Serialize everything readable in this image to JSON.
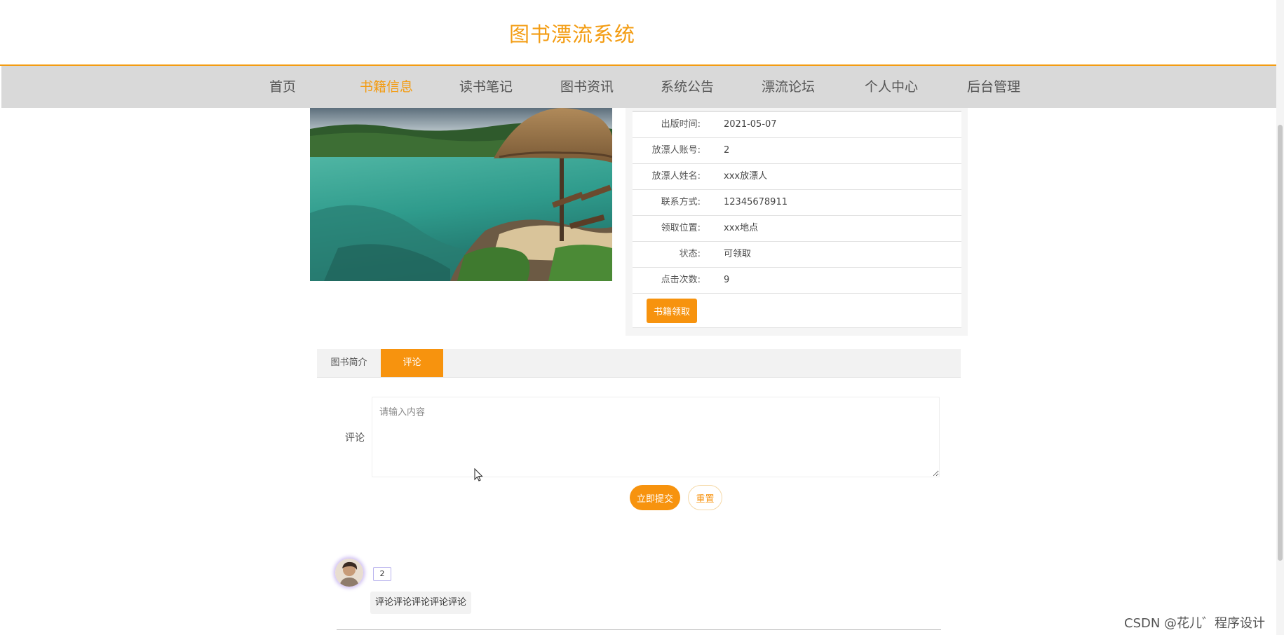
{
  "header": {
    "site_title": "图书漂流系统"
  },
  "nav": {
    "items": [
      {
        "label": "首页",
        "active": false
      },
      {
        "label": "书籍信息",
        "active": true
      },
      {
        "label": "读书笔记",
        "active": false
      },
      {
        "label": "图书资讯",
        "active": false
      },
      {
        "label": "系统公告",
        "active": false
      },
      {
        "label": "漂流论坛",
        "active": false
      },
      {
        "label": "个人中心",
        "active": false
      },
      {
        "label": "后台管理",
        "active": false
      }
    ]
  },
  "book": {
    "details": [
      {
        "label": "出版时间:",
        "value": "2021-05-07"
      },
      {
        "label": "放漂人账号:",
        "value": "2"
      },
      {
        "label": "放漂人姓名:",
        "value": "xxx放漂人"
      },
      {
        "label": "联系方式:",
        "value": "12345678911"
      },
      {
        "label": "领取位置:",
        "value": "xxx地点"
      },
      {
        "label": "状态:",
        "value": "可领取"
      },
      {
        "label": "点击次数:",
        "value": "9"
      }
    ],
    "claim_button": "书籍领取"
  },
  "tabs": {
    "intro": "图书简介",
    "comment": "评论"
  },
  "comment_form": {
    "label": "评论",
    "placeholder": "请输入内容",
    "submit": "立即提交",
    "reset": "重置"
  },
  "comments": [
    {
      "user": "2",
      "text": "评论评论评论评论评论"
    }
  ],
  "watermark": "CSDN @花儿゛程序设计",
  "colors": {
    "accent": "#f39c12",
    "button": "#f7930e",
    "nav_bg": "#d9d9d9"
  }
}
